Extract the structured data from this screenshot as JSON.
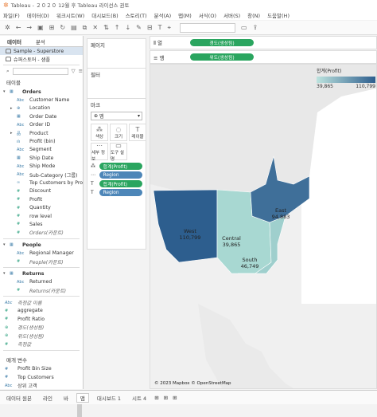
{
  "title_bar": {
    "text": "Tableau - ２０２０ 12월 후 Tableau 라이선스 권토"
  },
  "menu": [
    "파일(F)",
    "데이터(D)",
    "워크시트(W)",
    "대시보드(B)",
    "스토리(T)",
    "분석(A)",
    "맵(M)",
    "서식(O)",
    "서버(S)",
    "창(N)",
    "도움말(H)"
  ],
  "left_panel": {
    "tabs": [
      "데이터",
      "분석"
    ],
    "data_sources": [
      "Sample - Superstore",
      "슈퍼스토어 - 샘플"
    ],
    "tables_header": "테이블",
    "search_placeholder": "검색",
    "orders": {
      "name": "Orders",
      "fields": [
        {
          "icon": "Abc",
          "name": "Customer Name",
          "caret": ""
        },
        {
          "icon": "⊕",
          "name": "Location",
          "caret": "▸"
        },
        {
          "icon": "▦",
          "name": "Order Date",
          "caret": ""
        },
        {
          "icon": "Abc",
          "name": "Order ID",
          "caret": ""
        },
        {
          "icon": "品",
          "name": "Product",
          "caret": "▸"
        },
        {
          "icon": "ılı",
          "name": "Profit (bin)",
          "caret": ""
        },
        {
          "icon": "Abc",
          "name": "Segment",
          "caret": ""
        },
        {
          "icon": "▦",
          "name": "Ship Date",
          "caret": ""
        },
        {
          "icon": "Abc",
          "name": "Ship Mode",
          "caret": ""
        },
        {
          "icon": "Abc",
          "name": "Sub-Category (그룹)",
          "caret": ""
        },
        {
          "icon": "∞",
          "name": "Top Customers by Profit",
          "caret": ""
        },
        {
          "icon": "#",
          "name": "Discount",
          "caret": "",
          "m": true
        },
        {
          "icon": "#",
          "name": "Profit",
          "caret": "",
          "m": true
        },
        {
          "icon": "#",
          "name": "Quantity",
          "caret": "",
          "m": true
        },
        {
          "icon": "#",
          "name": "row level",
          "caret": "",
          "m": true
        },
        {
          "icon": "#",
          "name": "Sales",
          "caret": "",
          "m": true
        },
        {
          "icon": "#",
          "name": "Orders(카운트)",
          "caret": "",
          "m": true,
          "italic": true
        }
      ]
    },
    "people": {
      "name": "People",
      "fields": [
        {
          "icon": "Abc",
          "name": "Regional Manager",
          "caret": ""
        },
        {
          "icon": "#",
          "name": "People(카운트)",
          "caret": "",
          "m": true,
          "italic": true
        }
      ]
    },
    "returns": {
      "name": "Returns",
      "fields": [
        {
          "icon": "Abc",
          "name": "Returned",
          "caret": ""
        },
        {
          "icon": "#",
          "name": "Returns(카운트)",
          "caret": "",
          "m": true,
          "italic": true
        }
      ]
    },
    "extra_fields": [
      {
        "icon": "Abc",
        "name": "측정값 이름",
        "italic": true
      },
      {
        "icon": "#",
        "name": "aggregate",
        "m": true
      },
      {
        "icon": "#",
        "name": "Profit Ratio",
        "m": true
      },
      {
        "icon": "⊕",
        "name": "경도(생성됨)",
        "m": true,
        "italic": true
      },
      {
        "icon": "⊕",
        "name": "위도(생성됨)",
        "m": true,
        "italic": true
      },
      {
        "icon": "#",
        "name": "측정값",
        "m": true,
        "italic": true
      }
    ],
    "params_header": "매개 변수",
    "params": [
      {
        "icon": "#",
        "name": "Profit Bin Size"
      },
      {
        "icon": "#",
        "name": "Top Customers"
      },
      {
        "icon": "Abc",
        "name": "상위 고객"
      }
    ]
  },
  "cards": {
    "pages": "페이지",
    "filters": "필터",
    "marks": "마크",
    "mark_type": "맵",
    "mark_buttons": [
      {
        "glyph": "⁂",
        "label": "색상"
      },
      {
        "glyph": "◌",
        "label": "크기"
      },
      {
        "glyph": "T",
        "label": "레이블"
      },
      {
        "glyph": "⋯",
        "label": "세부 정보"
      },
      {
        "glyph": "▭",
        "label": "도구 설명"
      }
    ],
    "mark_pills": [
      {
        "icon": "⁂",
        "label": "합계(Profit)",
        "color": "green"
      },
      {
        "icon": "⋯",
        "label": "Region",
        "color": "blue"
      },
      {
        "icon": "T",
        "label": "합계(Profit)",
        "color": "green"
      },
      {
        "icon": "T",
        "label": "Region",
        "color": "blue"
      }
    ]
  },
  "shelves": {
    "columns_label": "열",
    "columns_pill": "경도(생성됨)",
    "rows_label": "행",
    "rows_pill": "위도(생성됨)"
  },
  "legend": {
    "title": "합계(Profit)",
    "min": "39,865",
    "max": "110,799"
  },
  "map": {
    "title": "맵",
    "attribution": "© 2023 Mapbox © OpenStreetMap",
    "regions": [
      {
        "name": "West",
        "value": "110,799",
        "color": "#2d5e8e"
      },
      {
        "name": "Central",
        "value": "39,865",
        "color": "#a8d8d2"
      },
      {
        "name": "East",
        "value": "94,883",
        "color": "#3f6f99"
      },
      {
        "name": "South",
        "value": "46,749",
        "color": "#9fcfcd"
      }
    ]
  },
  "colors": {
    "pill_green": "#2aa55f",
    "pill_blue": "#4d86b8",
    "legend_low": "#bde3de",
    "legend_high": "#2d5e8e"
  },
  "bottom_bar": {
    "tabs": [
      "데이터 원본",
      "라인",
      "바",
      "맵",
      "대시보드 1",
      "시트 4"
    ],
    "active": "맵"
  }
}
